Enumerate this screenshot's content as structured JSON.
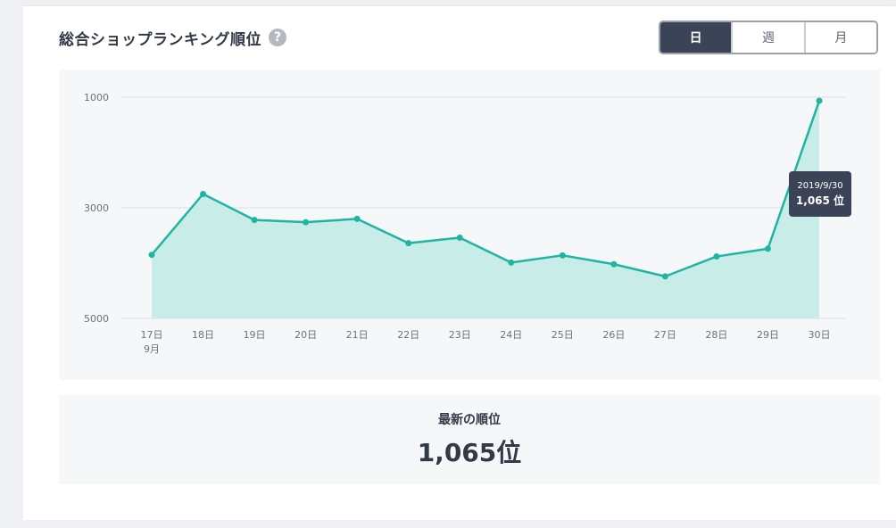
{
  "header": {
    "title": "総合ショップランキング順位",
    "help_icon": "?"
  },
  "period_toggle": {
    "options": [
      "日",
      "週",
      "月"
    ],
    "selected": "日"
  },
  "colors": {
    "line": "#1fb5a2",
    "area": "#c8ece7",
    "active_button": "#3b4457",
    "grid": "#dcdfe5"
  },
  "chart_data": {
    "type": "area",
    "x": [
      "17日",
      "18日",
      "19日",
      "20日",
      "21日",
      "22日",
      "23日",
      "24日",
      "25日",
      "26日",
      "27日",
      "28日",
      "29日",
      "30日"
    ],
    "x_sublabel": {
      "17日": "9月"
    },
    "values": [
      3850,
      2750,
      3220,
      3260,
      3200,
      3640,
      3540,
      3990,
      3860,
      4020,
      4240,
      3880,
      3740,
      1065
    ],
    "ylim": [
      5000,
      1000
    ],
    "y_inverted": true,
    "yticks": [
      1000,
      3000,
      5000
    ],
    "grid": true,
    "tooltip": {
      "date": "2019/9/30",
      "value": "1,065 位"
    }
  },
  "latest": {
    "label": "最新の順位",
    "value": "1,065位"
  }
}
